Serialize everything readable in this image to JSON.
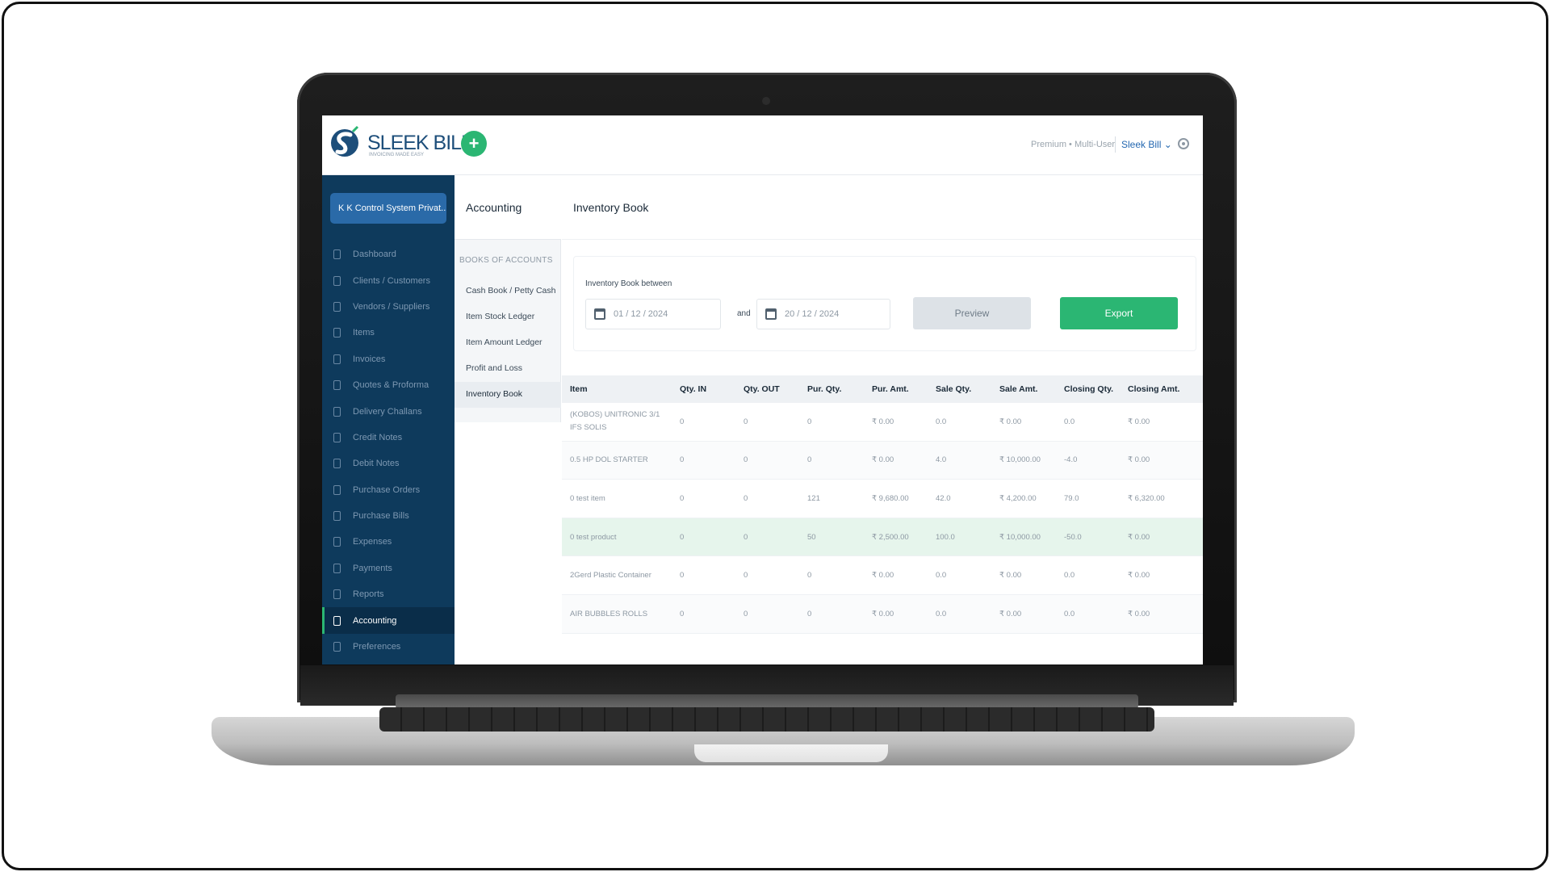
{
  "header": {
    "brand": "SLEEK BILL",
    "tagline": "INVOICING MADE EASY",
    "add_label": "+",
    "plan": "Premium • Multi-User",
    "user": "Sleek Bill ⌄"
  },
  "sidebar": {
    "company": "K K Control System Privat...",
    "items": [
      {
        "label": "Dashboard"
      },
      {
        "label": "Clients / Customers"
      },
      {
        "label": "Vendors / Suppliers"
      },
      {
        "label": "Items"
      },
      {
        "label": "Invoices"
      },
      {
        "label": "Quotes & Proforma"
      },
      {
        "label": "Delivery Challans"
      },
      {
        "label": "Credit Notes"
      },
      {
        "label": "Debit Notes"
      },
      {
        "label": "Purchase Orders"
      },
      {
        "label": "Purchase Bills"
      },
      {
        "label": "Expenses"
      },
      {
        "label": "Payments"
      },
      {
        "label": "Reports"
      },
      {
        "label": "Accounting"
      },
      {
        "label": "Preferences"
      }
    ]
  },
  "submenu": {
    "title": "Accounting",
    "section": "BOOKS OF ACCOUNTS",
    "items": [
      {
        "label": "Cash Book / Petty Cash"
      },
      {
        "label": "Item Stock Ledger"
      },
      {
        "label": "Item Amount Ledger"
      },
      {
        "label": "Profit and Loss"
      },
      {
        "label": "Inventory Book"
      }
    ]
  },
  "main": {
    "title": "Inventory Book",
    "filter_label": "Inventory Book between",
    "date_from": "01 / 12 / 2024",
    "and_label": "and",
    "date_to": "20 / 12 / 2024",
    "preview_label": "Preview",
    "export_label": "Export"
  },
  "table": {
    "columns": [
      "Item",
      "Qty. IN",
      "Qty. OUT",
      "Pur. Qty.",
      "Pur. Amt.",
      "Sale Qty.",
      "Sale Amt.",
      "Closing Qty.",
      "Closing Amt."
    ],
    "rows": [
      [
        "(KOBOS) UNITRONIC 3/1 IFS SOLIS",
        "0",
        "0",
        "0",
        "₹ 0.00",
        "0.0",
        "₹ 0.00",
        "0.0",
        "₹ 0.00"
      ],
      [
        "0.5 HP DOL STARTER",
        "0",
        "0",
        "0",
        "₹ 0.00",
        "4.0",
        "₹ 10,000.00",
        "-4.0",
        "₹ 0.00"
      ],
      [
        "0 test item",
        "0",
        "0",
        "121",
        "₹ 9,680.00",
        "42.0",
        "₹ 4,200.00",
        "79.0",
        "₹ 6,320.00"
      ],
      [
        "0 test product",
        "0",
        "0",
        "50",
        "₹ 2,500.00",
        "100.0",
        "₹ 10,000.00",
        "-50.0",
        "₹ 0.00"
      ],
      [
        "2Gerd Plastic Container",
        "0",
        "0",
        "0",
        "₹ 0.00",
        "0.0",
        "₹ 0.00",
        "0.0",
        "₹ 0.00"
      ],
      [
        "AIR BUBBLES ROLLS",
        "0",
        "0",
        "0",
        "₹ 0.00",
        "0.0",
        "₹ 0.00",
        "0.0",
        "₹ 0.00"
      ]
    ]
  },
  "colors": {
    "sidebar": "#0e3a5c",
    "accent": "#2bb673",
    "link": "#2367b0"
  }
}
